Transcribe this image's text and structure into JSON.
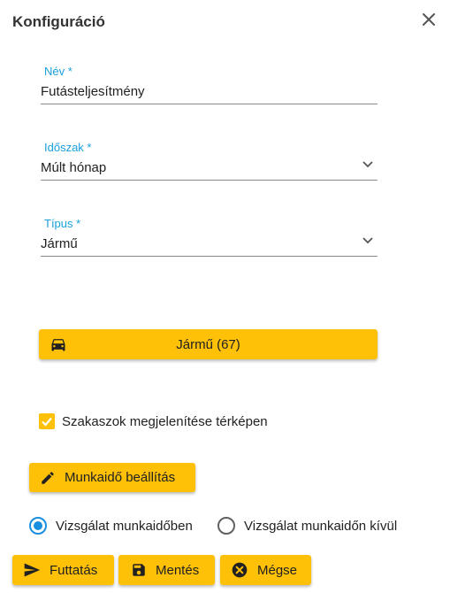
{
  "dialog": {
    "title": "Konfiguráció"
  },
  "fields": {
    "name": {
      "label": "Név *",
      "value": "Futásteljesítmény"
    },
    "period": {
      "label": "Időszak *",
      "value": "Múlt hónap"
    },
    "type": {
      "label": "Típus *",
      "value": "Jármű"
    }
  },
  "vehicle_button": {
    "label": "Jármű (67)"
  },
  "show_segments": {
    "label": "Szakaszok megjelenítése térképen",
    "checked": true
  },
  "work_hours_button": {
    "label": "Munkaidő beállítás"
  },
  "radios": [
    {
      "label": "Vizsgálat munkaidőben",
      "selected": true
    },
    {
      "label": "Vizsgálat munkaidőn kívül",
      "selected": false
    }
  ],
  "actions": {
    "run": "Futtatás",
    "save": "Mentés",
    "cancel": "Mégse"
  },
  "colors": {
    "accent": "#ffc107",
    "label_blue": "#1aa0db",
    "radio_blue": "#1a8fe0"
  }
}
